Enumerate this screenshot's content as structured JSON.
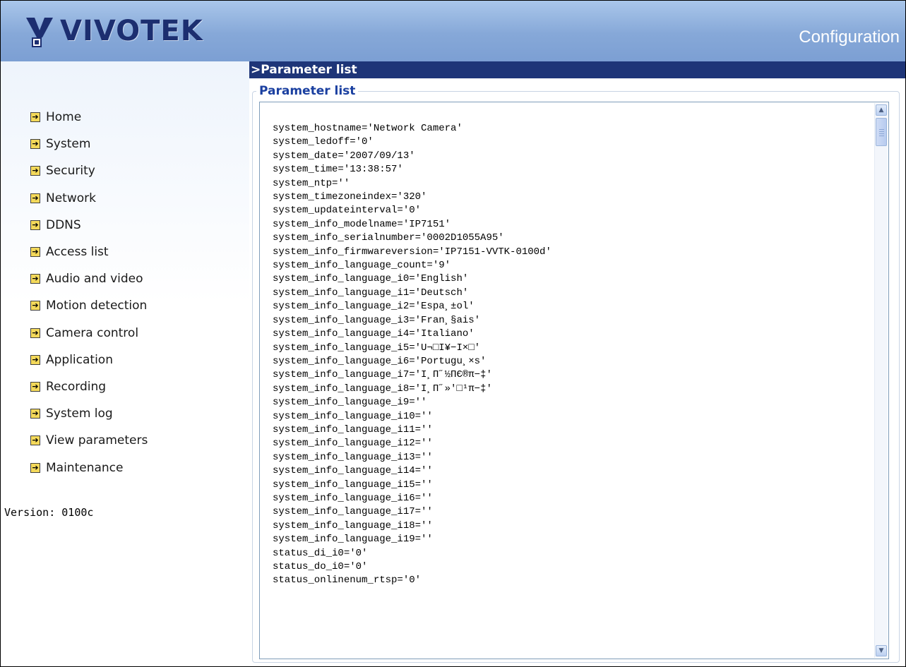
{
  "header": {
    "logo_text": "VIVOTEK",
    "title": "Configuration"
  },
  "sidebar": {
    "items": [
      {
        "label": "Home",
        "icon": "arrow-right-icon"
      },
      {
        "label": "System",
        "icon": "arrow-right-icon"
      },
      {
        "label": "Security",
        "icon": "arrow-right-icon"
      },
      {
        "label": "Network",
        "icon": "arrow-right-icon"
      },
      {
        "label": "DDNS",
        "icon": "arrow-right-icon"
      },
      {
        "label": "Access list",
        "icon": "arrow-right-icon"
      },
      {
        "label": "Audio and video",
        "icon": "arrow-right-icon"
      },
      {
        "label": "Motion detection",
        "icon": "arrow-right-icon"
      },
      {
        "label": "Camera control",
        "icon": "arrow-right-icon"
      },
      {
        "label": "Application",
        "icon": "arrow-right-icon"
      },
      {
        "label": "Recording",
        "icon": "arrow-right-icon"
      },
      {
        "label": "System log",
        "icon": "arrow-right-icon"
      },
      {
        "label": "View parameters",
        "icon": "arrow-right-icon"
      },
      {
        "label": "Maintenance",
        "icon": "arrow-right-icon"
      }
    ],
    "version": "Version: 0100c"
  },
  "main": {
    "titlebar": ">Parameter list",
    "legend": "Parameter list",
    "parameters": [
      "system_hostname='Network Camera'",
      "system_ledoff='0'",
      "system_date='2007/09/13'",
      "system_time='13:38:57'",
      "system_ntp=''",
      "system_timezoneindex='320'",
      "system_updateinterval='0'",
      "system_info_modelname='IP7151'",
      "system_info_serialnumber='0002D1055A95'",
      "system_info_firmwareversion='IP7151-VVTK-0100d'",
      "system_info_language_count='9'",
      "system_info_language_i0='English'",
      "system_info_language_i1='Deutsch'",
      "system_info_language_i2='Espa¸±ol'",
      "system_info_language_i3='Fran¸§ais'",
      "system_info_language_i4='Italiano'",
      "system_info_language_i5='U¬□I¥−I×□'",
      "system_info_language_i6='Portugu¸×s'",
      "system_info_language_i7='I¸Π˝½ΠЄ®π−‡'",
      "system_info_language_i8='I¸Π˝»'□¹π−‡'",
      "system_info_language_i9=''",
      "system_info_language_i10=''",
      "system_info_language_i11=''",
      "system_info_language_i12=''",
      "system_info_language_i13=''",
      "system_info_language_i14=''",
      "system_info_language_i15=''",
      "system_info_language_i16=''",
      "system_info_language_i17=''",
      "system_info_language_i18=''",
      "system_info_language_i19=''",
      "status_di_i0='0'",
      "status_do_i0='0'",
      "status_onlinenum_rtsp='0'"
    ]
  }
}
